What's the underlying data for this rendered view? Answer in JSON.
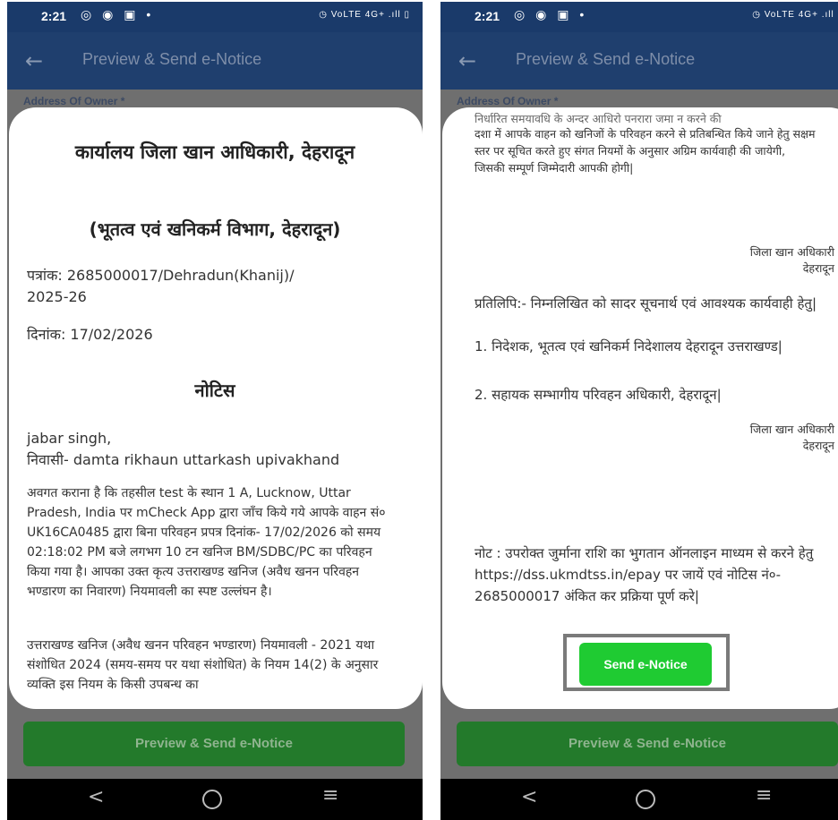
{
  "status": {
    "time": "2:21",
    "left_icons": "◎ ◉ ▣ •",
    "right_icons": "◷ VoLTE 4G+ .ıll ▯"
  },
  "app_bar": {
    "title": "Preview & Send e-Notice",
    "back_icon": "arrow-left"
  },
  "form": {
    "field_label": "Address Of Owner *"
  },
  "bottom_button": {
    "label": "Preview & Send e-Notice"
  },
  "left_modal": {
    "office_title": "कार्यालय जिला खान आधिकारी, देहरादून",
    "dept_title": "(भूतत्व एवं खनिकर्म विभाग, देहरादून)",
    "ref_line1": "पत्रांक: 2685000017/Dehradun(Khanij)/",
    "ref_line2": "2025-26",
    "date_line": "दिनांक: 17/02/2026",
    "notice_heading": "नोटिस",
    "recipient_name": "jabar singh,",
    "recipient_address": "निवासी- damta rikhaun uttarkash upivakhand",
    "para1": "अवगत कराना है कि तहसील test के स्थान 1 A, Lucknow, Uttar Pradesh, India पर mCheck App द्वारा जाँच किये गये आपके वाहन सं० UK16CA0485 द्वारा बिना परिवहन प्रपत्र दिनांक- 17/02/2026 को समय 02:18:02 PM बजे लगभग 10 टन खनिज BM/SDBC/PC का परिवहन किया गया है। आपका उक्त कृत्य उत्तराखण्ड खनिज (अवैध खनन परिवहन भण्डारण का निवारण) नियमावली का स्पष्ट उल्लंघन है।",
    "para2": "उत्तराखण्ड खनिज (अवैध खनन परिवहन भण्डारण) नियमावली - 2021 यथा संशोधित 2024 (समय-समय पर यथा संशोधित) के नियम 14(2) के अनुसार व्यक्ति इस नियम के किसी उपबन्ध का"
  },
  "right_modal": {
    "cut_line": "निर्धारित समयावधि के अन्दर आधिरो पनरारा जमा न करने की",
    "para_top": "दशा में आपके वाहन को खनिजों के परिवहन करने से प्रतिबन्धित किये जाने हेतु सक्षम स्तर पर सूचित करते हुए संगत नियमों के अनुसार अग्रिम कार्यवाही की जायेगी, जिसकी सम्पूर्ण जिम्मेदारी आपकी होगी|",
    "sign1_line1": "जिला खान अधिकारी",
    "sign1_line2": "देहरादून",
    "copy_heading": "प्रतिलिपि:- निम्नलिखित को सादर सूचनार्थ एवं आवश्यक कार्यवाही हेतु|",
    "copy_item1": "1. निदेशक, भूतत्व एवं खनिकर्म निदेशालय देहरादून उत्तराखण्ड|",
    "copy_item2": "2. सहायक सम्भागीय परिवहन अधिकारी, देहरादून|",
    "sign2_line1": "जिला खान अधिकारी",
    "sign2_line2": "देहरादून",
    "note": "नोट : उपरोक्त जुर्माना राशि का भुगतान ऑनलाइन माध्यम से करने हेतु https://dss.ukmdtss.in/epay पर जायें एवं नोटिस नं०- 2685000017 अंकित कर प्रक्रिया पूर्ण करे|",
    "send_button": "Send e-Notice"
  },
  "nav": {
    "back": "<",
    "home": "○",
    "menu": "≡"
  }
}
